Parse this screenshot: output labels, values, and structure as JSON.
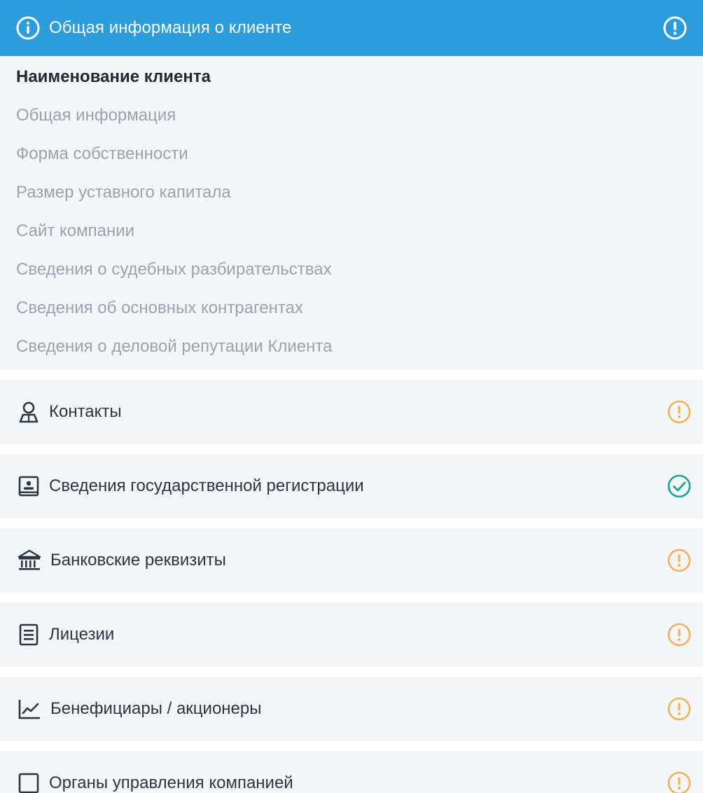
{
  "active_section": {
    "title": "Общая информация о клиенте",
    "leading_icon": "info-icon",
    "status_icon": "alert-icon",
    "items": [
      {
        "label": "Наименование клиента",
        "active": true
      },
      {
        "label": "Общая информация",
        "active": false
      },
      {
        "label": "Форма собственности",
        "active": false
      },
      {
        "label": "Размер уставного капитала",
        "active": false
      },
      {
        "label": "Сайт компании",
        "active": false
      },
      {
        "label": "Сведения о судебных разбирательствах",
        "active": false
      },
      {
        "label": "Сведения об основных контрагентах",
        "active": false
      },
      {
        "label": "Сведения о деловой репутации Клиента",
        "active": false
      }
    ]
  },
  "sections": [
    {
      "label": "Контакты",
      "icon": "person-icon",
      "status": "warning"
    },
    {
      "label": "Сведения государственной регистрации",
      "icon": "id-card-icon",
      "status": "done"
    },
    {
      "label": "Банковские реквизиты",
      "icon": "bank-icon",
      "status": "warning"
    },
    {
      "label": "Лицезии",
      "icon": "document-icon",
      "status": "warning"
    },
    {
      "label": "Бенефициары / акционеры",
      "icon": "chart-icon",
      "status": "warning"
    },
    {
      "label": "Органы управления компанией",
      "icon": "square-icon",
      "status": "warning"
    }
  ],
  "colors": {
    "header_bg": "#2d9cdb",
    "panel_bg": "#f3f6f9",
    "warning": "#f2b15a",
    "done": "#1aa58c",
    "icon": "#2a3540",
    "muted_text": "#99a3ad",
    "active_text": "#1f2933"
  }
}
